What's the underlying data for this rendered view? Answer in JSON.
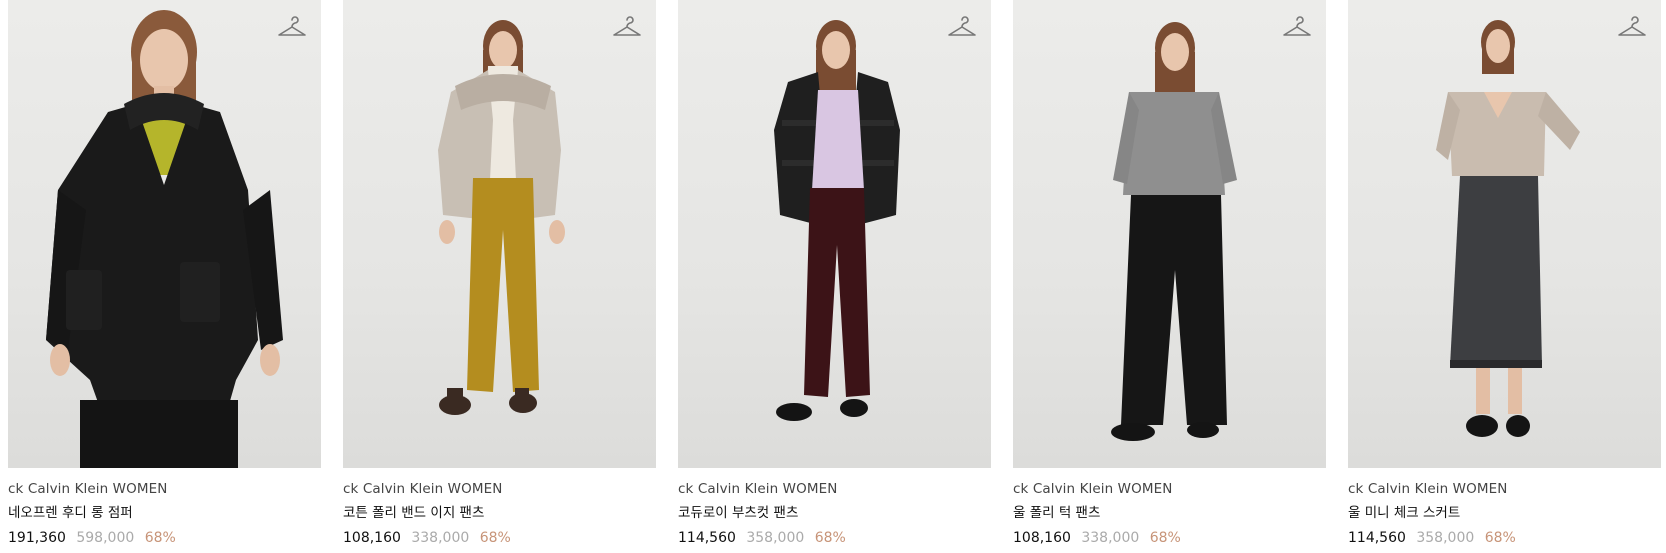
{
  "products": [
    {
      "brand": "ck Calvin Klein WOMEN",
      "name": "네오프렌 후디 롱 점퍼",
      "sale_price": "191,360",
      "original_price": "598,000",
      "discount": "68%",
      "colors": {
        "top": "#1a1a1a",
        "inner": "#b5b52b",
        "bottom": "#141414",
        "shoes": "#141414"
      }
    },
    {
      "brand": "ck Calvin Klein WOMEN",
      "name": "코튼 폴리 밴드 이지 팬츠",
      "sale_price": "108,160",
      "original_price": "338,000",
      "discount": "68%",
      "colors": {
        "top": "#c8bfb4",
        "inner": "#eee9e0",
        "bottom": "#b48d1f",
        "shoes": "#3a2a22"
      }
    },
    {
      "brand": "ck Calvin Klein WOMEN",
      "name": "코듀로이 부츠컷 팬츠",
      "sale_price": "114,560",
      "original_price": "358,000",
      "discount": "68%",
      "colors": {
        "top": "#1f1f1f",
        "inner": "#d9c6e2",
        "bottom": "#3c1317",
        "shoes": "#141414"
      }
    },
    {
      "brand": "ck Calvin Klein WOMEN",
      "name": "울 폴리 턱 팬츠",
      "sale_price": "108,160",
      "original_price": "338,000",
      "discount": "68%",
      "colors": {
        "top": "#8f8f8f",
        "inner": "#8f8f8f",
        "bottom": "#161616",
        "shoes": "#141414"
      }
    },
    {
      "brand": "ck Calvin Klein WOMEN",
      "name": "울 미니 체크 스커트",
      "sale_price": "114,560",
      "original_price": "358,000",
      "discount": "68%",
      "colors": {
        "top": "#c9bcaf",
        "inner": "#c9bcaf",
        "bottom": "#3d3e41",
        "shoes": "#141414"
      }
    }
  ],
  "icons": {
    "wishlist": "hanger-icon"
  },
  "colors": {
    "discount": "#c79478",
    "original_price": "#aaaaaa",
    "sale_price": "#111111"
  }
}
